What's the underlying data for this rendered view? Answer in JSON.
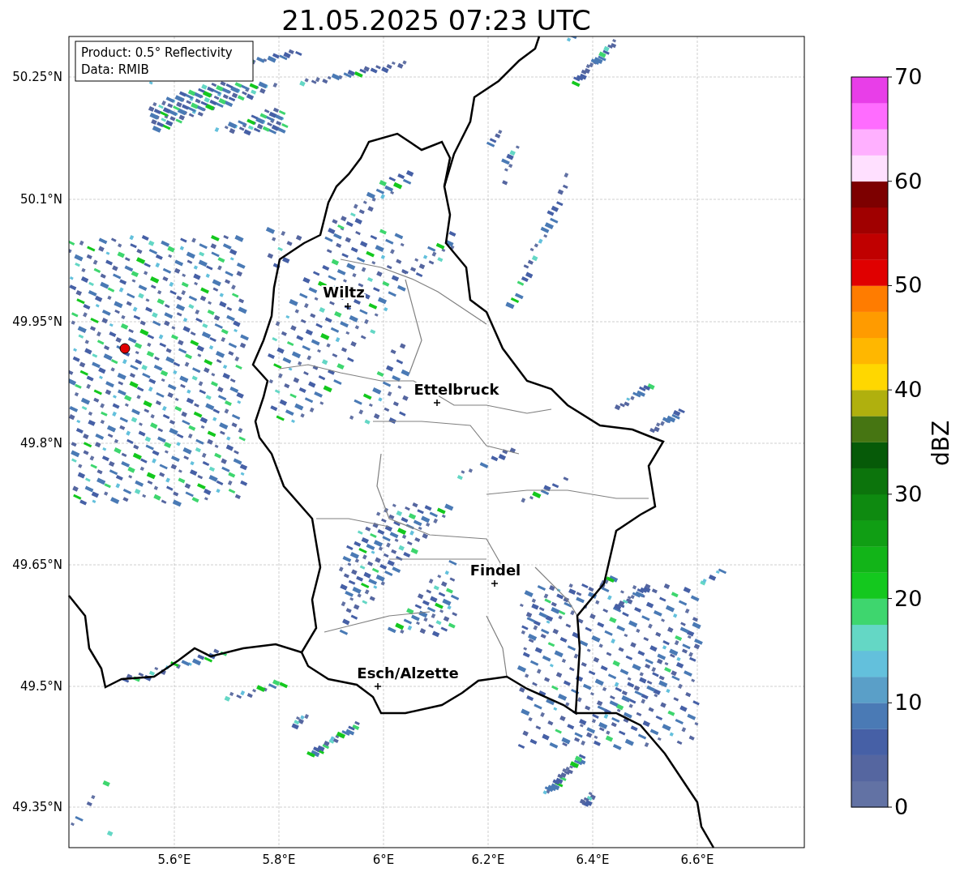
{
  "title": "21.05.2025 07:23 UTC",
  "info_box": [
    "Product: 0.5° Reflectivity",
    "Data: RMIB"
  ],
  "cities": [
    {
      "name": "Wiltz"
    },
    {
      "name": "Ettelbruck"
    },
    {
      "name": "Findel"
    },
    {
      "name": "Esch/Alzette"
    }
  ],
  "x_ticks": [
    "5.6°E",
    "5.8°E",
    "6°E",
    "6.2°E",
    "6.4°E",
    "6.6°E"
  ],
  "y_ticks": [
    "50.25°N",
    "50.1°N",
    "49.95°N",
    "49.8°N",
    "49.65°N",
    "49.5°N",
    "49.35°N"
  ],
  "colorbar": {
    "label": "dBZ",
    "ticks": [
      "70",
      "60",
      "50",
      "40",
      "30",
      "20",
      "10",
      "0"
    ],
    "segments": [
      {
        "color": "#6272a4"
      },
      {
        "color": "#5566a0"
      },
      {
        "color": "#4660a6"
      },
      {
        "color": "#4a7ab5"
      },
      {
        "color": "#5a9fc8"
      },
      {
        "color": "#63c0dc"
      },
      {
        "color": "#64d7c5"
      },
      {
        "color": "#3ed66e"
      },
      {
        "color": "#14c81e"
      },
      {
        "color": "#12b418"
      },
      {
        "color": "#109e14"
      },
      {
        "color": "#0e8a10"
      },
      {
        "color": "#0c740c"
      },
      {
        "color": "#065a08"
      },
      {
        "color": "#467512"
      },
      {
        "color": "#b0b00e"
      },
      {
        "color": "#ffd700"
      },
      {
        "color": "#ffb700"
      },
      {
        "color": "#ff9b00"
      },
      {
        "color": "#ff7c00"
      },
      {
        "color": "#e00000"
      },
      {
        "color": "#c00000"
      },
      {
        "color": "#a00000"
      },
      {
        "color": "#7d0000"
      },
      {
        "color": "#ffe0ff"
      },
      {
        "color": "#ffb0ff"
      },
      {
        "color": "#ff6cff"
      },
      {
        "color": "#e83ee8"
      }
    ]
  }
}
